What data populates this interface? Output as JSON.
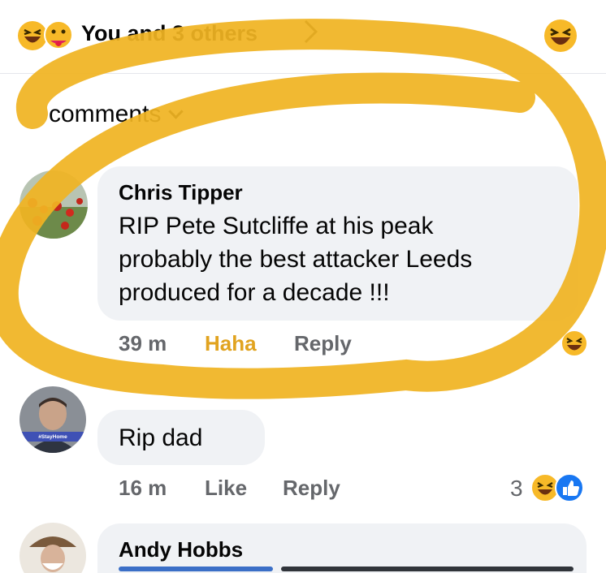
{
  "reactions": {
    "summary": "You and 3 others",
    "icons": [
      "haha-icon",
      "care-icon"
    ],
    "right_icon": "haha-icon"
  },
  "filter": {
    "label": "comments"
  },
  "comments": [
    {
      "author": "Chris Tipper",
      "text_lines": [
        "RIP Pete Sutcliffe at his peak",
        "probably the best attacker Leeds",
        "produced for a decade !!!"
      ],
      "time": "39 m",
      "reaction_label": "Haha",
      "reply_label": "Reply",
      "reaction_icon": "haha-icon"
    },
    {
      "author": "",
      "avatar_badge": "#StayHome",
      "text": "Rip dad",
      "time": "16 m",
      "like_label": "Like",
      "reply_label": "Reply",
      "reaction_count": "3",
      "reaction_icons": [
        "haha-icon",
        "like-icon"
      ]
    },
    {
      "author": "Andy Hobbs"
    }
  ],
  "colors": {
    "bubble": "#f0f2f5",
    "meta": "#65676b",
    "haha": "#e1a31f",
    "annotation_ring": "#f0b422",
    "like_blue": "#1877f2"
  }
}
